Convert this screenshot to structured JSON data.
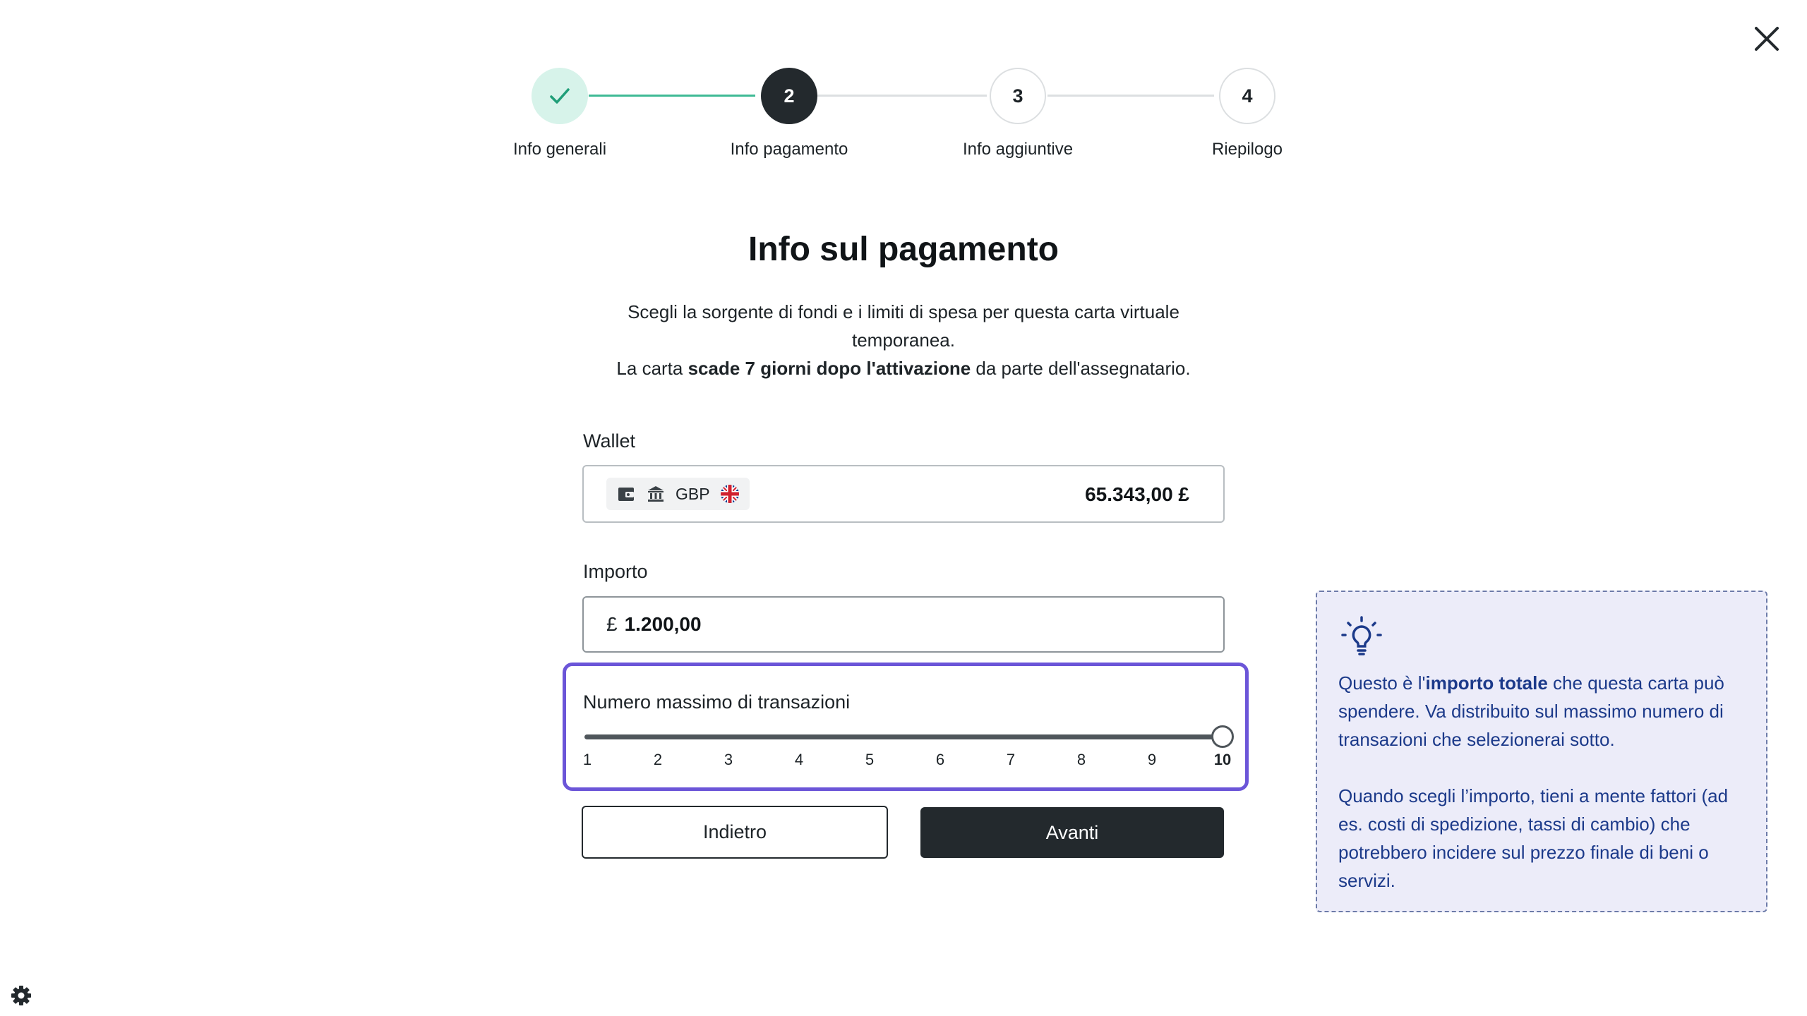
{
  "stepper": {
    "steps": [
      {
        "number": "1",
        "label": "Info generali",
        "state": "done"
      },
      {
        "number": "2",
        "label": "Info pagamento",
        "state": "active"
      },
      {
        "number": "3",
        "label": "Info aggiuntive",
        "state": "todo"
      },
      {
        "number": "4",
        "label": "Riepilogo",
        "state": "todo"
      }
    ]
  },
  "page": {
    "title": "Info sul pagamento",
    "desc_line1": "Scegli la sorgente di fondi e i limiti di spesa per questa carta virtuale temporanea.",
    "desc_line2_pre": "La carta ",
    "desc_line2_bold": "scade 7 giorni dopo l'attivazione",
    "desc_line2_post": " da parte dell'assegnatario."
  },
  "wallet": {
    "label": "Wallet",
    "currency": "GBP",
    "balance": "65.343,00 £",
    "icons": [
      "wallet-icon",
      "bank-icon",
      "uk-flag-icon"
    ]
  },
  "amount": {
    "label": "Importo",
    "currency_symbol": "£",
    "value": "1.200,00"
  },
  "transactions": {
    "label": "Numero massimo di transazioni",
    "ticks": [
      "1",
      "2",
      "3",
      "4",
      "5",
      "6",
      "7",
      "8",
      "9",
      "10"
    ],
    "selected": 10,
    "min": 1,
    "max": 10
  },
  "buttons": {
    "back": "Indietro",
    "next": "Avanti"
  },
  "info": {
    "icon": "lightbulb-icon",
    "p1_pre": "Questo è l'",
    "p1_bold": "importo totale",
    "p1_post": " che questa carta può spendere. Va distribuito sul massimo numero di transazioni che selezionerai sotto.",
    "p2": "Quando scegli l’importo, tieni a mente fattori (ad es. costi di spedizione, tassi di cambio) che potrebbero incidere sul prezzo finale di beni o servizi."
  },
  "colors": {
    "accent": "#6b55d8",
    "dark": "#23292d",
    "success": "#3fba95",
    "info_bg": "#ececf9",
    "info_text": "#1c3a8a"
  }
}
